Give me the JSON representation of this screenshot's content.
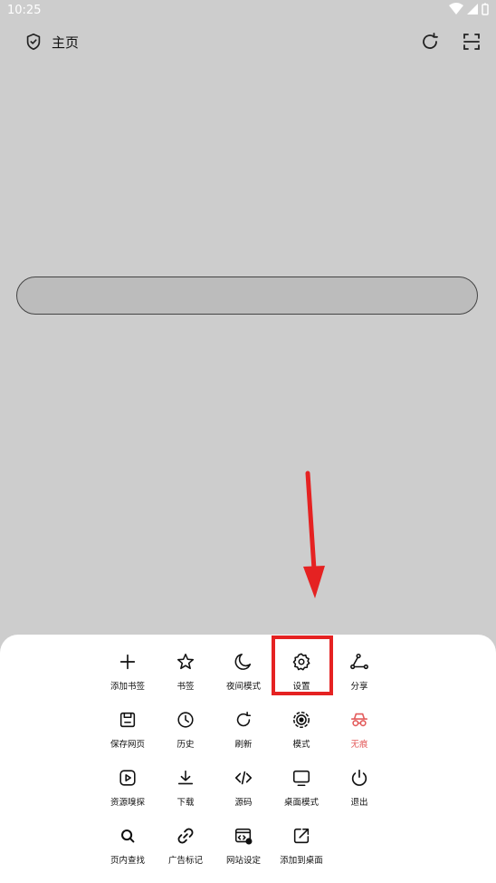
{
  "status_bar": {
    "time": "10:25"
  },
  "toolbar": {
    "title": "主页"
  },
  "search": {
    "value": ""
  },
  "menu": {
    "items": [
      {
        "label": "添加书签",
        "icon": "plus-icon"
      },
      {
        "label": "书签",
        "icon": "star-icon"
      },
      {
        "label": "夜间模式",
        "icon": "moon-icon"
      },
      {
        "label": "设置",
        "icon": "gear-icon"
      },
      {
        "label": "分享",
        "icon": "share-icon"
      },
      {
        "label": "保存网页",
        "icon": "save-icon"
      },
      {
        "label": "历史",
        "icon": "history-icon"
      },
      {
        "label": "刷新",
        "icon": "refresh-icon"
      },
      {
        "label": "模式",
        "icon": "mode-icon"
      },
      {
        "label": "无痕",
        "icon": "incognito-icon"
      },
      {
        "label": "资源嗅探",
        "icon": "play-icon"
      },
      {
        "label": "下载",
        "icon": "download-icon"
      },
      {
        "label": "源码",
        "icon": "code-icon"
      },
      {
        "label": "桌面模式",
        "icon": "monitor-icon"
      },
      {
        "label": "退出",
        "icon": "power-icon"
      },
      {
        "label": "页内查找",
        "icon": "search-icon"
      },
      {
        "label": "广告标记",
        "icon": "link-icon"
      },
      {
        "label": "网站设定",
        "icon": "site-settings-icon"
      },
      {
        "label": "添加到桌面",
        "icon": "add-to-desktop-icon"
      }
    ]
  },
  "colors": {
    "highlight": "#e52222",
    "incognito": "#e35b5b",
    "backdrop": "#cdcdcd"
  }
}
